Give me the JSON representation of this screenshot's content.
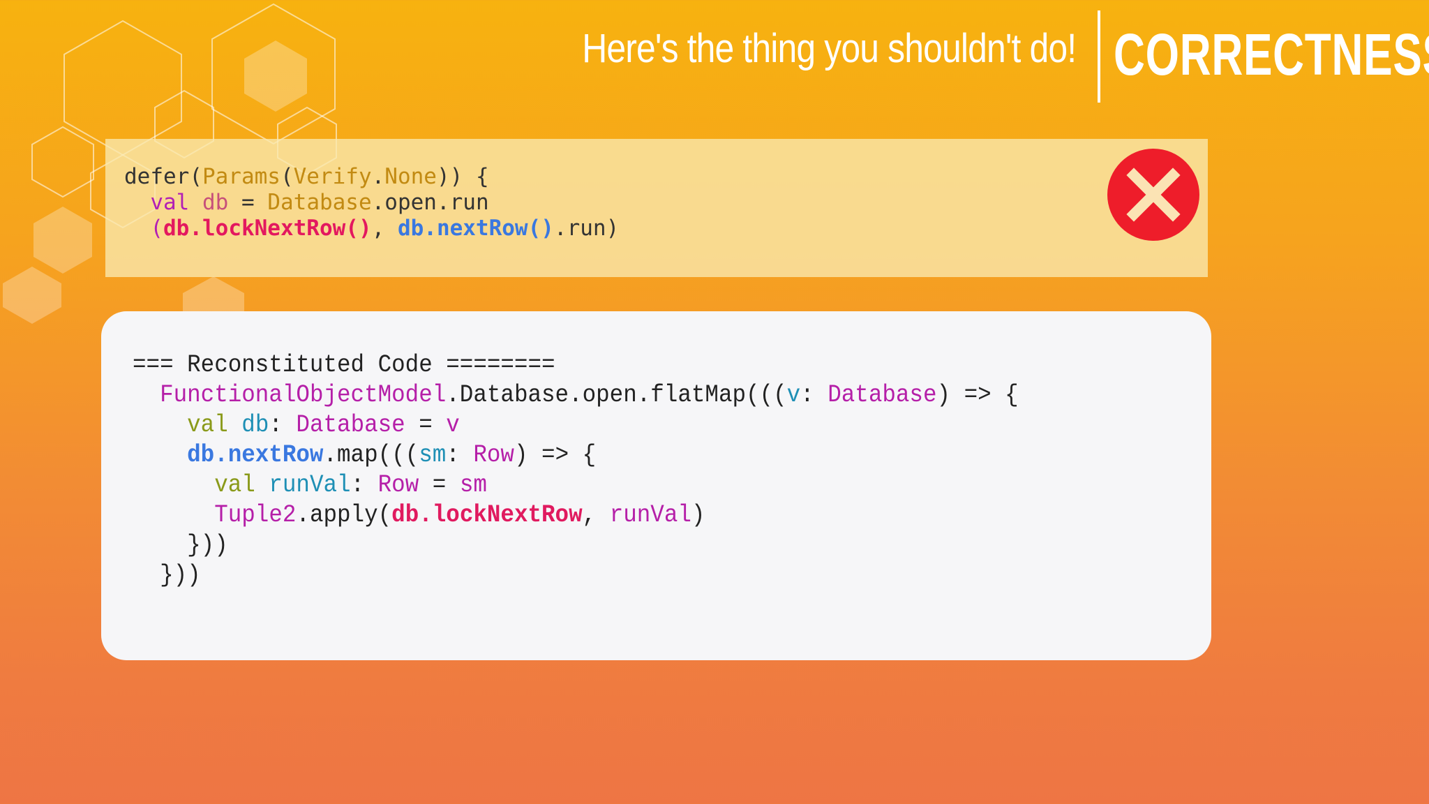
{
  "header": {
    "title": "Here's the thing you shouldn't do!",
    "section": "CORRECTNESS"
  },
  "bad_code": {
    "line1": {
      "kw": "defer(",
      "a": "Params",
      "b": "(",
      "c": "Verify",
      "d": ".",
      "e": "None",
      "f": ")) {"
    },
    "line2": {
      "indent": "  ",
      "val": "val",
      "sp": " ",
      "db": "db",
      "eq": " = ",
      "database": "Database",
      "rest": ".open.run"
    },
    "line3": {
      "indent": "  ",
      "open": "(",
      "lock": "db.lockNextRow()",
      "comma": ", ",
      "next": "db.nextRow()",
      "rest": ".run)"
    },
    "status_icon": "close-icon",
    "status_color": "#ee1d2a"
  },
  "reconstituted": {
    "line1": "=== Reconstituted Code ========",
    "line2": {
      "indent": "  ",
      "fom": "FunctionalObjectModel",
      "mid": ".Database.open.flatMap(((",
      "v": "v",
      "colon": ": ",
      "database": "Database",
      "end": ") => {"
    },
    "line3": {
      "indent": "    ",
      "val": "val",
      "sp": " ",
      "db": "db",
      "colon": ": ",
      "database": "Database",
      "eq": " = ",
      "v": "v"
    },
    "line4": {
      "indent": "    ",
      "next": "db.nextRow",
      "mid": ".map(((",
      "sm": "sm",
      "colon": ": ",
      "row": "Row",
      "end": ") => {"
    },
    "line5": {
      "indent": "      ",
      "val": "val",
      "sp": " ",
      "runval": "runVal",
      "colon": ": ",
      "row": "Row",
      "eq": " = ",
      "sm": "sm"
    },
    "line6": {
      "indent": "      ",
      "tuple": "Tuple2",
      "mid": ".apply(",
      "lock": "db.lockNextRow",
      "comma": ", ",
      "runval": "runVal",
      "end": ")"
    },
    "line7": "    }))",
    "line8": "  }))"
  }
}
